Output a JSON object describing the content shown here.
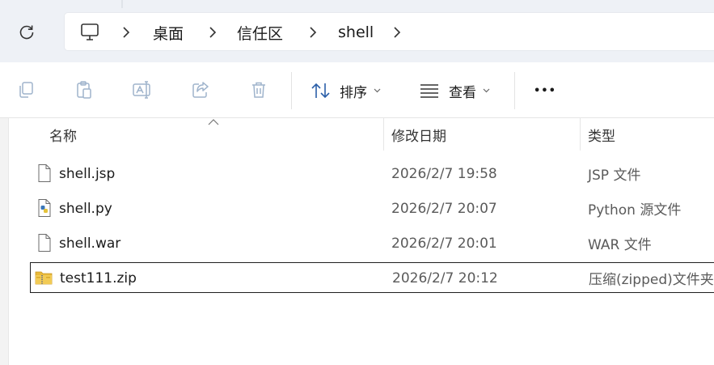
{
  "addressbar": {
    "breadcrumbs": [
      "桌面",
      "信任区",
      "shell"
    ]
  },
  "toolbar": {
    "sort_label": "排序",
    "view_label": "查看",
    "more_label": "•••"
  },
  "columns": {
    "name": "名称",
    "date": "修改日期",
    "type": "类型"
  },
  "files": [
    {
      "name": "shell.jsp",
      "date": "2026/2/7 19:58",
      "type": "JSP 文件",
      "icon": "blank-file-icon"
    },
    {
      "name": "shell.py",
      "date": "2026/2/7 20:07",
      "type": "Python 源文件",
      "icon": "python-file-icon"
    },
    {
      "name": "shell.war",
      "date": "2026/2/7 20:01",
      "type": "WAR 文件",
      "icon": "blank-file-icon"
    },
    {
      "name": "test111.zip",
      "date": "2026/2/7 20:12",
      "type": "压缩(zipped)文件夹",
      "icon": "zip-folder-icon"
    }
  ],
  "colors": {
    "accent": "#2b6cb0",
    "selection_border": "#1f1f1f",
    "zip_folder": "#e8b93a"
  }
}
